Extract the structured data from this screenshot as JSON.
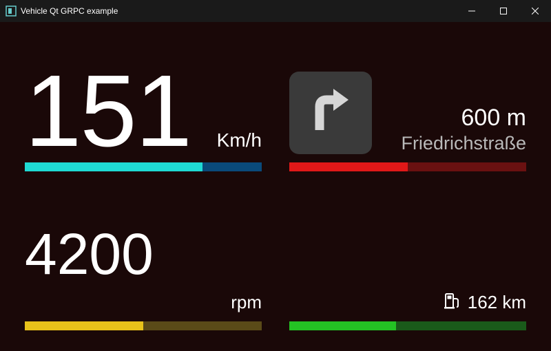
{
  "window": {
    "title": "Vehicle Qt GRPC example"
  },
  "speed": {
    "value": "151",
    "unit": "Km/h",
    "bar": {
      "fill_pct": 75,
      "fill_color": "#1fdad3",
      "track_color": "#0a4a7a"
    }
  },
  "rpm": {
    "value": "4200",
    "unit": "rpm",
    "bar": {
      "fill_pct": 50,
      "fill_color": "#e8c21a",
      "track_color": "#5a4a18"
    }
  },
  "navigation": {
    "direction_icon": "turn-right-icon",
    "distance": "600 m",
    "street": "Friedrichstraße",
    "bar": {
      "fill_pct": 50,
      "fill_color": "#e01818",
      "track_color": "#6a1111"
    }
  },
  "fuel": {
    "icon": "fuel-pump-icon",
    "range": "162 km",
    "bar": {
      "fill_pct": 45,
      "fill_color": "#24c224",
      "track_color": "#1a5a1a"
    }
  },
  "colors": {
    "background": "#1a0808",
    "titlebar": "#1a1a1a",
    "text_primary": "#ffffff",
    "text_secondary": "#b9b9b9"
  }
}
